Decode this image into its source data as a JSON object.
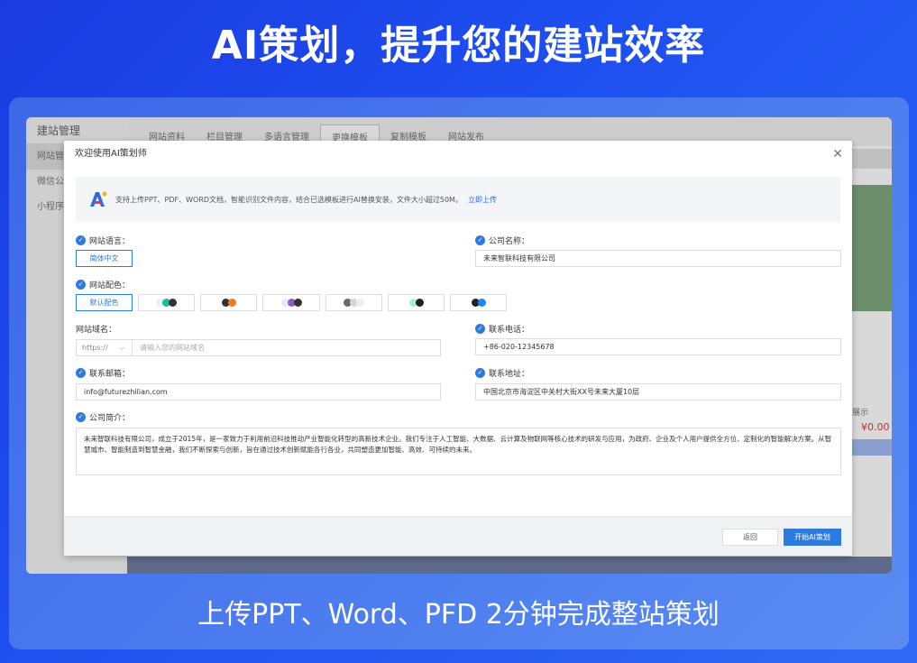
{
  "hero": {
    "title": "AI策划，提升您的建站效率",
    "subtitle": "上传PPT、Word、PFD 2分钟完成整站策划"
  },
  "app": {
    "title": "建站管理",
    "sidebar_items": [
      "网站管",
      "微信公众",
      "小程序"
    ],
    "tabs": [
      "网站资料",
      "栏目管理",
      "多语言管理",
      "更换模板",
      "复制模板",
      "网站发布"
    ],
    "active_tab": "更换模板",
    "right_label": "展示",
    "right_price": "¥0.00"
  },
  "modal": {
    "title": "欢迎使用AI策划师",
    "notice_text": "支持上传PPT、PDF、WORD文档，智能识别文件内容，结合已选模板进行AI替换安装，文件大小超过50M。",
    "notice_link": "立即上传",
    "fields": {
      "language_label": "网站语言：",
      "language_value": "简体中文",
      "company_name_label": "公司名称：",
      "company_name_value": "未来智联科技有限公司",
      "color_label": "网站配色：",
      "color_default": "默认配色",
      "domain_label": "网站域名：",
      "domain_protocol": "https://",
      "domain_placeholder": "请输入您的网站域名",
      "phone_label": "联系电话：",
      "phone_value": "+86-020-12345678",
      "email_label": "联系邮箱：",
      "email_value": "info@futurezhilian.com",
      "address_label": "联系地址：",
      "address_value": "中国北京市海淀区中关村大街XX号未来大厦10层",
      "intro_label": "公司简介：",
      "intro_value": "未来智联科技有限公司，成立于2015年，是一家致力于利用前沿科技推动产业智能化转型的高新技术企业。我们专注于人工智能、大数据、云计算及物联网等核心技术的研发与应用，为政府、企业及个人用户提供全方位、定制化的智能解决方案。从智慧城市、智能制造到智慧金融，我们不断探索与创新，旨在通过技术创新赋能各行各业，共同塑造更加智能、高效、可持续的未来。"
    },
    "swatches": [
      {
        "colors": [
          "#e6f4f1",
          "#1fb7a6",
          "#333333"
        ]
      },
      {
        "colors": [
          "#333333",
          "#f07c1e"
        ]
      },
      {
        "colors": [
          "#ece6f6",
          "#8e5cc9",
          "#333333"
        ]
      },
      {
        "colors": [
          "#5b6b78",
          "#d9d5cf",
          "#eeeeee"
        ]
      },
      {
        "colors": [
          "#a7efc8",
          "#222222"
        ]
      },
      {
        "colors": [
          "#222222",
          "#1e88f0"
        ]
      }
    ],
    "back_label": "返回",
    "start_label": "开始AI策划",
    "accent": "#2d7be0"
  }
}
